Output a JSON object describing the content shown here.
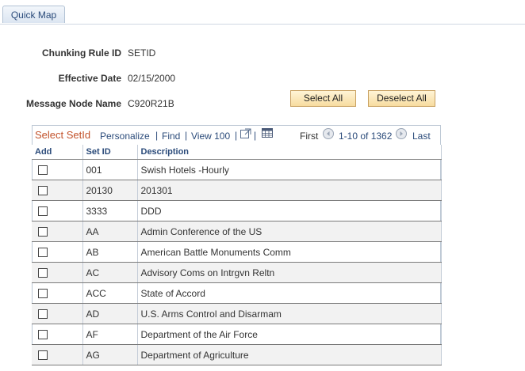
{
  "tab": {
    "label": "Quick Map"
  },
  "fields": {
    "chunking_rule_label": "Chunking Rule ID",
    "chunking_rule_value": "SETID",
    "effective_date_label": "Effective Date",
    "effective_date_value": "02/15/2000",
    "message_node_label": "Message Node Name",
    "message_node_value": "C920R21B"
  },
  "buttons": {
    "select_all": "Select All",
    "deselect_all": "Deselect All"
  },
  "grid": {
    "title": "Select SetId",
    "personalize": "Personalize",
    "find": "Find",
    "view": "View 100",
    "first": "First",
    "range": "1-10 of 1362",
    "last": "Last",
    "sep": "|",
    "columns": {
      "add": "Add",
      "setid": "Set ID",
      "description": "Description"
    },
    "rows": [
      {
        "setid": "001",
        "description": "Swish Hotels -Hourly"
      },
      {
        "setid": "20130",
        "description": "201301"
      },
      {
        "setid": "3333",
        "description": "DDD"
      },
      {
        "setid": "AA",
        "description": "Admin Conference of the US"
      },
      {
        "setid": "AB",
        "description": "American Battle Monuments Comm"
      },
      {
        "setid": "AC",
        "description": "Advisory Coms on Intrgvn Reltn"
      },
      {
        "setid": "ACC",
        "description": "State of Accord"
      },
      {
        "setid": "AD",
        "description": "U.S. Arms Control and Disarmam"
      },
      {
        "setid": "AF",
        "description": "Department of the Air Force"
      },
      {
        "setid": "AG",
        "description": "Department of Agriculture"
      }
    ]
  },
  "icons": {
    "zoom": "new-window-icon",
    "download": "spreadsheet-icon",
    "prev": "previous-arrow-icon",
    "next": "next-arrow-icon"
  }
}
